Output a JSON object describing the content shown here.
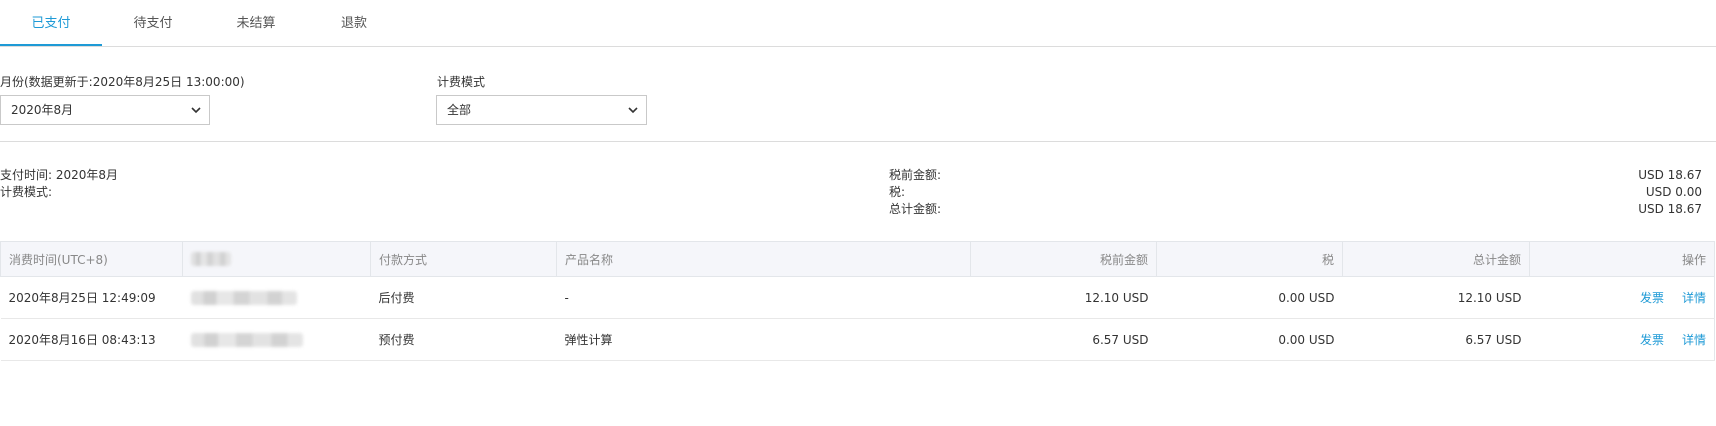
{
  "tabs": [
    {
      "label": "已支付",
      "active": true
    },
    {
      "label": "待支付",
      "active": false
    },
    {
      "label": "未结算",
      "active": false
    },
    {
      "label": "退款",
      "active": false
    }
  ],
  "filters": {
    "month_label": "月份(数据更新于:2020年8月25日 13:00:00)",
    "month_value": "2020年8月",
    "mode_label": "计费模式",
    "mode_value": "全部"
  },
  "summary": {
    "pay_time": "支付时间: 2020年8月",
    "billing_mode": "计费模式:",
    "pretax_label": "税前金额:",
    "tax_label": "税:",
    "total_label": "总计金额:",
    "pretax_value": "USD 18.67",
    "tax_value": "USD 0.00",
    "total_value": "USD 18.67"
  },
  "table": {
    "columns": [
      "消费时间(UTC+8)",
      "",
      "付款方式",
      "产品名称",
      "税前金额",
      "税",
      "总计金额",
      "操作"
    ],
    "rows": [
      {
        "time": "2020年8月25日 12:49:09",
        "pay_method": "后付费",
        "product": "-",
        "pretax": "12.10 USD",
        "tax": "0.00 USD",
        "total": "12.10 USD",
        "invoice": "发票",
        "detail": "详情"
      },
      {
        "time": "2020年8月16日 08:43:13",
        "pay_method": "预付费",
        "product": "弹性计算",
        "pretax": "6.57 USD",
        "tax": "0.00 USD",
        "total": "6.57 USD",
        "invoice": "发票",
        "detail": "详情"
      }
    ]
  },
  "colors": {
    "accent": "#1e9ad6",
    "header_bg": "#f5f6fa",
    "border": "#dcdcdc"
  },
  "icons": {
    "select_chevron": "chevron-down-icon"
  }
}
